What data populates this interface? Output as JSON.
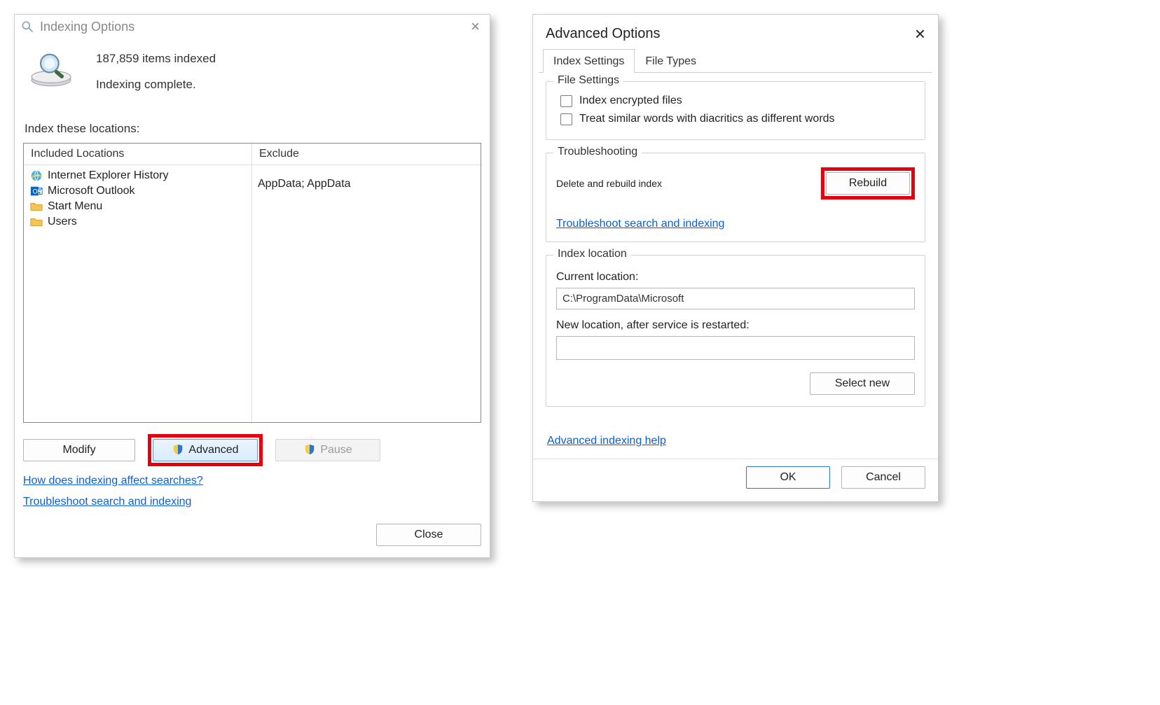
{
  "left": {
    "title": "Indexing Options",
    "items_indexed": "187,859 items indexed",
    "status": "Indexing complete.",
    "index_locations_label": "Index these locations:",
    "columns": {
      "included": "Included Locations",
      "exclude": "Exclude"
    },
    "rows": [
      {
        "icon": "ie-icon",
        "name": "Internet Explorer History",
        "exclude": ""
      },
      {
        "icon": "outlook-icon",
        "name": "Microsoft Outlook",
        "exclude": ""
      },
      {
        "icon": "folder-icon",
        "name": "Start Menu",
        "exclude": ""
      },
      {
        "icon": "folder-icon",
        "name": "Users",
        "exclude": "AppData; AppData"
      }
    ],
    "buttons": {
      "modify": "Modify",
      "advanced": "Advanced",
      "pause": "Pause",
      "close": "Close"
    },
    "links": {
      "how_affect": "How does indexing affect searches?",
      "troubleshoot": "Troubleshoot search and indexing"
    }
  },
  "right": {
    "title": "Advanced Options",
    "tabs": {
      "index_settings": "Index Settings",
      "file_types": "File Types"
    },
    "file_settings": {
      "title": "File Settings",
      "encrypted": "Index encrypted files",
      "diacritics": "Treat similar words with diacritics as different words"
    },
    "troubleshooting": {
      "title": "Troubleshooting",
      "rebuild_label": "Delete and rebuild index",
      "rebuild_button": "Rebuild",
      "link": "Troubleshoot search and indexing"
    },
    "index_location": {
      "title": "Index location",
      "current_label": "Current location:",
      "current_value": "C:\\ProgramData\\Microsoft",
      "new_label": "New location, after service is restarted:",
      "new_value": "",
      "select_new": "Select new"
    },
    "help_link": "Advanced indexing help",
    "buttons": {
      "ok": "OK",
      "cancel": "Cancel"
    }
  }
}
